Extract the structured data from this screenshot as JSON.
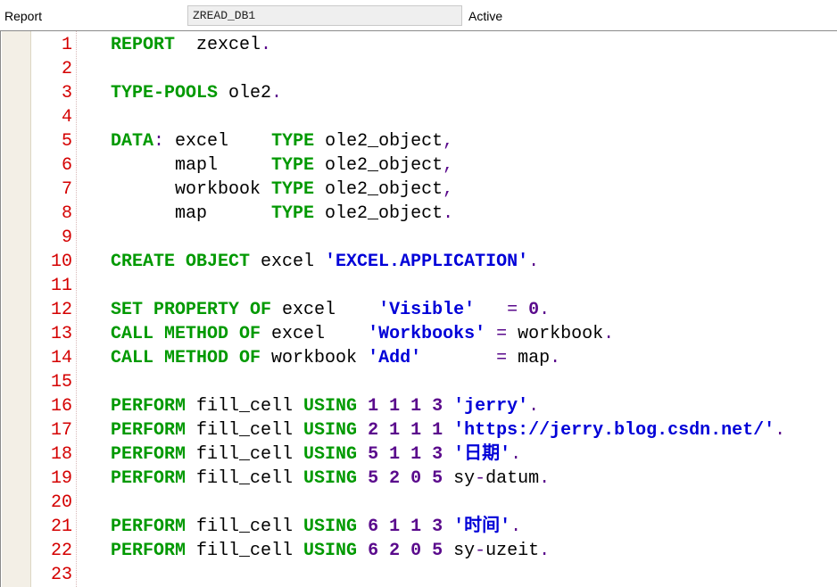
{
  "header": {
    "type_label": "Report",
    "program_name": "ZREAD_DB1",
    "status": "Active"
  },
  "colors": {
    "keyword": "#009900",
    "string": "#0000d8",
    "number": "#5a0a8c",
    "line_number": "#d40000"
  },
  "lines": [
    {
      "num": "1",
      "tokens": [
        [
          "kw",
          "REPORT"
        ],
        [
          "id",
          "  zexcel"
        ],
        [
          "pun",
          "."
        ]
      ]
    },
    {
      "num": "2",
      "tokens": []
    },
    {
      "num": "3",
      "tokens": [
        [
          "kw",
          "TYPE-POOLS"
        ],
        [
          "id",
          " ole2"
        ],
        [
          "pun",
          "."
        ]
      ]
    },
    {
      "num": "4",
      "tokens": []
    },
    {
      "num": "5",
      "tokens": [
        [
          "kw",
          "DATA"
        ],
        [
          "pun",
          ":"
        ],
        [
          "id",
          " excel    "
        ],
        [
          "kw",
          "TYPE"
        ],
        [
          "id",
          " ole2_object"
        ],
        [
          "pun",
          ","
        ]
      ]
    },
    {
      "num": "6",
      "tokens": [
        [
          "id",
          "      mapl     "
        ],
        [
          "kw",
          "TYPE"
        ],
        [
          "id",
          " ole2_object"
        ],
        [
          "pun",
          ","
        ]
      ]
    },
    {
      "num": "7",
      "tokens": [
        [
          "id",
          "      workbook "
        ],
        [
          "kw",
          "TYPE"
        ],
        [
          "id",
          " ole2_object"
        ],
        [
          "pun",
          ","
        ]
      ]
    },
    {
      "num": "8",
      "tokens": [
        [
          "id",
          "      map      "
        ],
        [
          "kw",
          "TYPE"
        ],
        [
          "id",
          " ole2_object"
        ],
        [
          "pun",
          "."
        ]
      ]
    },
    {
      "num": "9",
      "tokens": []
    },
    {
      "num": "10",
      "tokens": [
        [
          "kw",
          "CREATE OBJECT"
        ],
        [
          "id",
          " excel "
        ],
        [
          "str",
          "'EXCEL.APPLICATION'"
        ],
        [
          "pun",
          "."
        ]
      ]
    },
    {
      "num": "11",
      "tokens": []
    },
    {
      "num": "12",
      "tokens": [
        [
          "kw",
          "SET PROPERTY OF"
        ],
        [
          "id",
          " excel    "
        ],
        [
          "str",
          "'Visible'"
        ],
        [
          "id",
          "   "
        ],
        [
          "pun",
          "="
        ],
        [
          "id",
          " "
        ],
        [
          "num",
          "0"
        ],
        [
          "pun",
          "."
        ]
      ]
    },
    {
      "num": "13",
      "tokens": [
        [
          "kw",
          "CALL METHOD OF"
        ],
        [
          "id",
          " excel    "
        ],
        [
          "str",
          "'Workbooks'"
        ],
        [
          "id",
          " "
        ],
        [
          "pun",
          "="
        ],
        [
          "id",
          " workbook"
        ],
        [
          "pun",
          "."
        ]
      ]
    },
    {
      "num": "14",
      "tokens": [
        [
          "kw",
          "CALL METHOD OF"
        ],
        [
          "id",
          " workbook "
        ],
        [
          "str",
          "'Add'"
        ],
        [
          "id",
          "       "
        ],
        [
          "pun",
          "="
        ],
        [
          "id",
          " map"
        ],
        [
          "pun",
          "."
        ]
      ]
    },
    {
      "num": "15",
      "tokens": []
    },
    {
      "num": "16",
      "tokens": [
        [
          "kw",
          "PERFORM"
        ],
        [
          "id",
          " fill_cell "
        ],
        [
          "kw",
          "USING"
        ],
        [
          "id",
          " "
        ],
        [
          "num",
          "1 1 1 3"
        ],
        [
          "id",
          " "
        ],
        [
          "str",
          "'jerry'"
        ],
        [
          "pun",
          "."
        ]
      ]
    },
    {
      "num": "17",
      "tokens": [
        [
          "kw",
          "PERFORM"
        ],
        [
          "id",
          " fill_cell "
        ],
        [
          "kw",
          "USING"
        ],
        [
          "id",
          " "
        ],
        [
          "num",
          "2 1 1 1"
        ],
        [
          "id",
          " "
        ],
        [
          "str",
          "'https://jerry.blog.csdn.net/'"
        ],
        [
          "pun",
          "."
        ]
      ]
    },
    {
      "num": "18",
      "tokens": [
        [
          "kw",
          "PERFORM"
        ],
        [
          "id",
          " fill_cell "
        ],
        [
          "kw",
          "USING"
        ],
        [
          "id",
          " "
        ],
        [
          "num",
          "5 1 1 3"
        ],
        [
          "id",
          " "
        ],
        [
          "str",
          "'日期'"
        ],
        [
          "pun",
          "."
        ]
      ]
    },
    {
      "num": "19",
      "tokens": [
        [
          "kw",
          "PERFORM"
        ],
        [
          "id",
          " fill_cell "
        ],
        [
          "kw",
          "USING"
        ],
        [
          "id",
          " "
        ],
        [
          "num",
          "5 2 0 5"
        ],
        [
          "id",
          " sy"
        ],
        [
          "pun",
          "-"
        ],
        [
          "id",
          "datum"
        ],
        [
          "pun",
          "."
        ]
      ]
    },
    {
      "num": "20",
      "tokens": []
    },
    {
      "num": "21",
      "tokens": [
        [
          "kw",
          "PERFORM"
        ],
        [
          "id",
          " fill_cell "
        ],
        [
          "kw",
          "USING"
        ],
        [
          "id",
          " "
        ],
        [
          "num",
          "6 1 1 3"
        ],
        [
          "id",
          " "
        ],
        [
          "str",
          "'时间'"
        ],
        [
          "pun",
          "."
        ]
      ]
    },
    {
      "num": "22",
      "tokens": [
        [
          "kw",
          "PERFORM"
        ],
        [
          "id",
          " fill_cell "
        ],
        [
          "kw",
          "USING"
        ],
        [
          "id",
          " "
        ],
        [
          "num",
          "6 2 0 5"
        ],
        [
          "id",
          " sy"
        ],
        [
          "pun",
          "-"
        ],
        [
          "id",
          "uzeit"
        ],
        [
          "pun",
          "."
        ]
      ]
    },
    {
      "num": "23",
      "tokens": []
    }
  ]
}
